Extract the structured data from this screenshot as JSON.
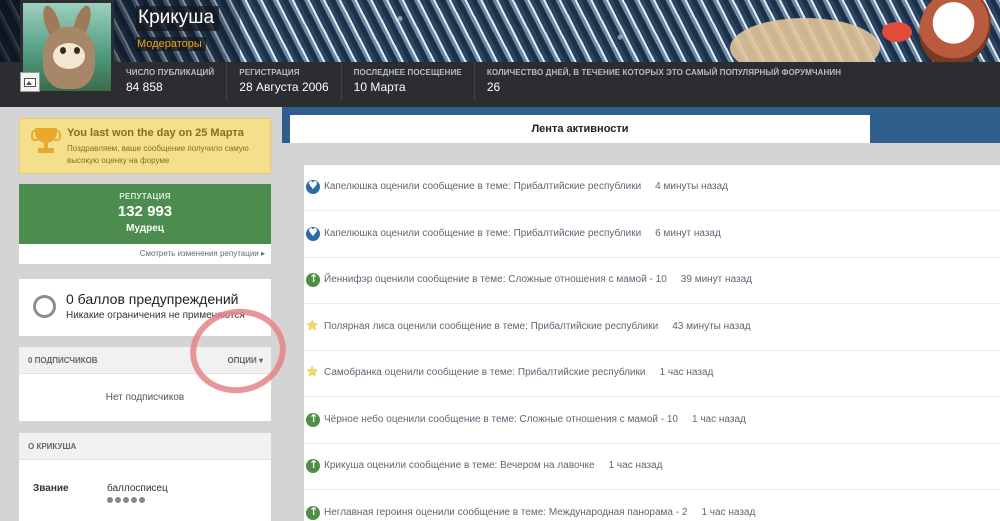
{
  "profile": {
    "name": "Крикуша",
    "group": "Модераторы",
    "stats": [
      {
        "label": "Число публикаций",
        "value": "84 858"
      },
      {
        "label": "Регистрация",
        "value": "28 Августа 2006"
      },
      {
        "label": "Последнее посещение",
        "value": "10 Марта"
      },
      {
        "label": "Количество дней, в течение которых это самый популярный форумчанин",
        "value": "26"
      }
    ]
  },
  "award": {
    "title": "You last won the day on 25 Марта",
    "desc": "Поздравляем, ваше сообщение получило самую высокую оценку на форуме"
  },
  "reputation": {
    "label": "РЕПУТАЦИЯ",
    "value": "132 993",
    "rank": "Мудрец",
    "link": "Смотреть изменения репутации ▸"
  },
  "warnings": {
    "title": "0 баллов предупреждений",
    "sub": "Никакие ограничения не применяются"
  },
  "followers": {
    "count": "0 ПОДПИСЧИКОВ",
    "options": "ОПЦИИ ▾",
    "empty": "Нет подписчиков"
  },
  "about": {
    "title": "О КРИКУША",
    "key": "Звание",
    "value": "баллосписец"
  },
  "tabs": {
    "activity": "Лента активности"
  },
  "feed": [
    {
      "icon": "heart",
      "text": "Капелюшка оценили сообщение в теме: Прибалтийские республики",
      "time": "4 минуты назад"
    },
    {
      "icon": "heart",
      "text": "Капелюшка оценили сообщение в теме: Прибалтийские республики",
      "time": "6 минут назад"
    },
    {
      "icon": "up",
      "text": "Йеннифэр оценили сообщение в теме: Сложные отношения с мамой - 10",
      "time": "39 минут назад"
    },
    {
      "icon": "star",
      "text": "Полярная лиса оценили сообщение в теме: Прибалтийские республики",
      "time": "43 минуты назад"
    },
    {
      "icon": "star",
      "text": "Самобранка оценили сообщение в теме: Прибалтийские республики",
      "time": "1 час назад"
    },
    {
      "icon": "up",
      "text": "Чёрное небо оценили сообщение в теме: Сложные отношения с мамой - 10",
      "time": "1 час назад"
    },
    {
      "icon": "up",
      "text": "Крикуша оценили сообщение в теме: Вечером на лавочке",
      "time": "1 час назад"
    },
    {
      "icon": "up",
      "text": "Неглавная героиня оценили сообщение в теме: Международная панорама - 2",
      "time": "1 час назад"
    }
  ]
}
